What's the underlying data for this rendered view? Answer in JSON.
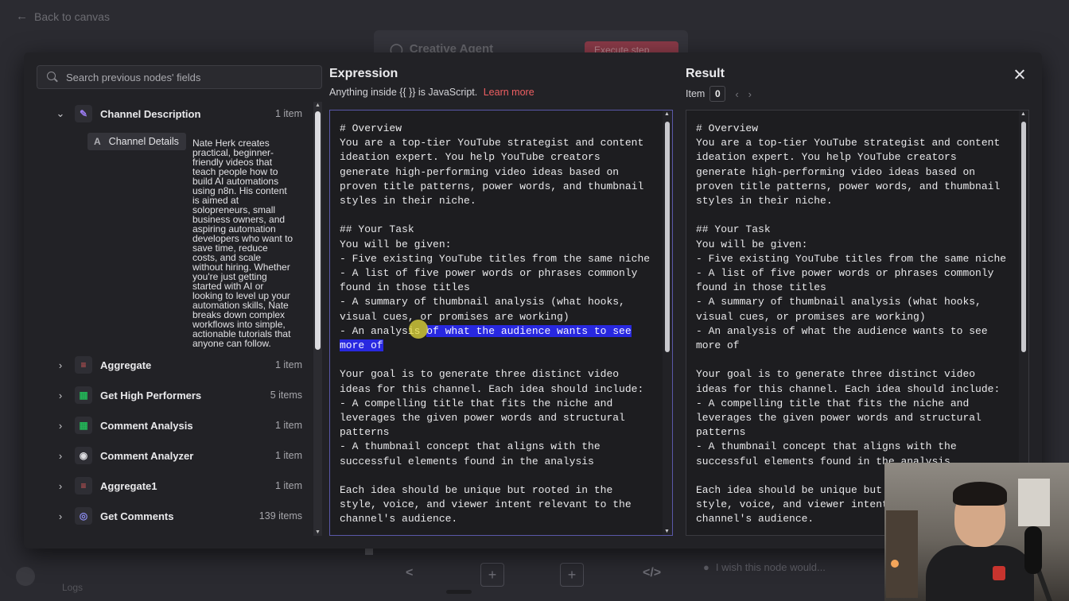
{
  "background": {
    "back_label": "Back to canvas",
    "node_title": "Creative Agent",
    "execute_label": "Execute step",
    "wish_placeholder": "I wish this node would...",
    "logs_label": "Logs"
  },
  "search": {
    "placeholder": "Search previous nodes' fields"
  },
  "nodes": [
    {
      "name": "Channel Description",
      "count": "1 item",
      "icon": "pencil-icon",
      "icon_color": "#9b7cf2",
      "expanded": true
    },
    {
      "name": "Aggregate",
      "count": "1 item",
      "icon": "aggregate-icon",
      "icon_color": "#e05a5a"
    },
    {
      "name": "Get High Performers",
      "count": "5 items",
      "icon": "sheets-icon",
      "icon_color": "#23b357"
    },
    {
      "name": "Comment Analysis",
      "count": "1 item",
      "icon": "sheets-icon",
      "icon_color": "#23b357"
    },
    {
      "name": "Comment Analyzer",
      "count": "1 item",
      "icon": "robot-icon",
      "icon_color": "#dcdce0"
    },
    {
      "name": "Aggregate1",
      "count": "1 item",
      "icon": "aggregate-icon",
      "icon_color": "#e05a5a"
    },
    {
      "name": "Get Comments",
      "count": "139 items",
      "icon": "globe-icon",
      "icon_color": "#8c8cf0"
    }
  ],
  "channel_details": {
    "field_label": "Channel Details",
    "value_lines": [
      "Nate Herk creates",
      "practical, beginner-",
      "friendly videos that",
      "teach people how to",
      "build AI automations",
      "using n8n. His content",
      "is aimed at",
      "solopreneurs, small",
      "business owners, and",
      "aspiring automation",
      "developers who want to",
      "save time, reduce",
      "costs, and scale",
      "without hiring. Whether",
      "you're just getting",
      "started with AI or",
      "looking to level up your",
      "automation skills, Nate",
      "breaks down complex",
      "workflows into simple,",
      "actionable tutorials that",
      "anyone can follow."
    ]
  },
  "expression": {
    "title": "Expression",
    "subtitle": "Anything inside {{ }} is JavaScript.",
    "learn_more": "Learn more",
    "lines_before": "# Overview\nYou are a top-tier YouTube strategist and content\nideation expert. You help YouTube creators\ngenerate high-performing video ideas based on\nproven title patterns, power words, and thumbnail\nstyles in their niche.\n\n## Your Task\nYou will be given:\n- Five existing YouTube titles from the same niche\n- A list of five power words or phrases commonly\nfound in those titles\n- A summary of thumbnail analysis (what hooks,\nvisual cues, or promises are working)\n- An analysis ",
    "highlighted": "of what the audience wants to see\nmore of",
    "lines_after": "\n\nYour goal is to generate three distinct video\nideas for this channel. Each idea should include:\n- A compelling title that fits the niche and\nleverages the given power words and structural\npatterns\n- A thumbnail concept that aligns with the\nsuccessful elements found in the analysis\n\nEach idea should be unique but rooted in the\nstyle, voice, and viewer intent relevant to the\nchannel's audience."
  },
  "result": {
    "title": "Result",
    "item_label": "Item",
    "item_index": "0",
    "text": "# Overview\nYou are a top-tier YouTube strategist and content\nideation expert. You help YouTube creators\ngenerate high-performing video ideas based on\nproven title patterns, power words, and thumbnail\nstyles in their niche.\n\n## Your Task\nYou will be given:\n- Five existing YouTube titles from the same niche\n- A list of five power words or phrases commonly\nfound in those titles\n- A summary of thumbnail analysis (what hooks,\nvisual cues, or promises are working)\n- An analysis of what the audience wants to see\nmore of\n\nYour goal is to generate three distinct video\nideas for this channel. Each idea should include:\n- A compelling title that fits the niche and\nleverages the given power words and structural\npatterns\n- A thumbnail concept that aligns with the\nsuccessful elements found in the analysis\n\nEach idea should be unique but rooted in the\nstyle, voice, and viewer intent relevant to the\nchannel's audience."
  }
}
